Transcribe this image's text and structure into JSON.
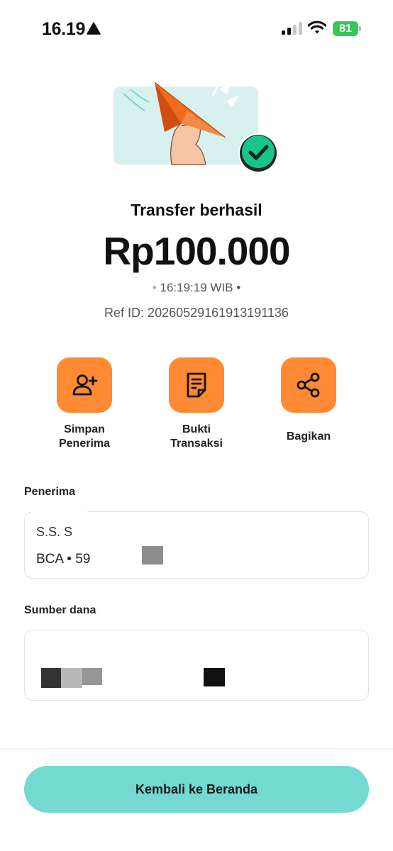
{
  "status_bar": {
    "time": "16.19",
    "battery": "81",
    "battery_color": "#34c759"
  },
  "colors": {
    "accent": "#ff8a33",
    "teal": "#74d9d1",
    "success": "#0fc98e"
  },
  "result": {
    "title": "Transfer berhasil",
    "amount": "Rp100.000",
    "time_text": "16:19:19 WIB",
    "ref_id": "Ref ID: 20260529161913191136"
  },
  "actions": [
    {
      "label": "Simpan\nPenerima",
      "icon": "add-user-icon"
    },
    {
      "label": "Bukti\nTransaksi",
      "icon": "receipt-icon"
    },
    {
      "label": "Bagikan",
      "icon": "share-icon"
    }
  ],
  "recipient": {
    "section_label": "Penerima",
    "name": "S.S. S",
    "account": "BCA • 59"
  },
  "source": {
    "section_label": "Sumber dana"
  },
  "footer": {
    "home_button_label": "Kembali ke Beranda"
  }
}
